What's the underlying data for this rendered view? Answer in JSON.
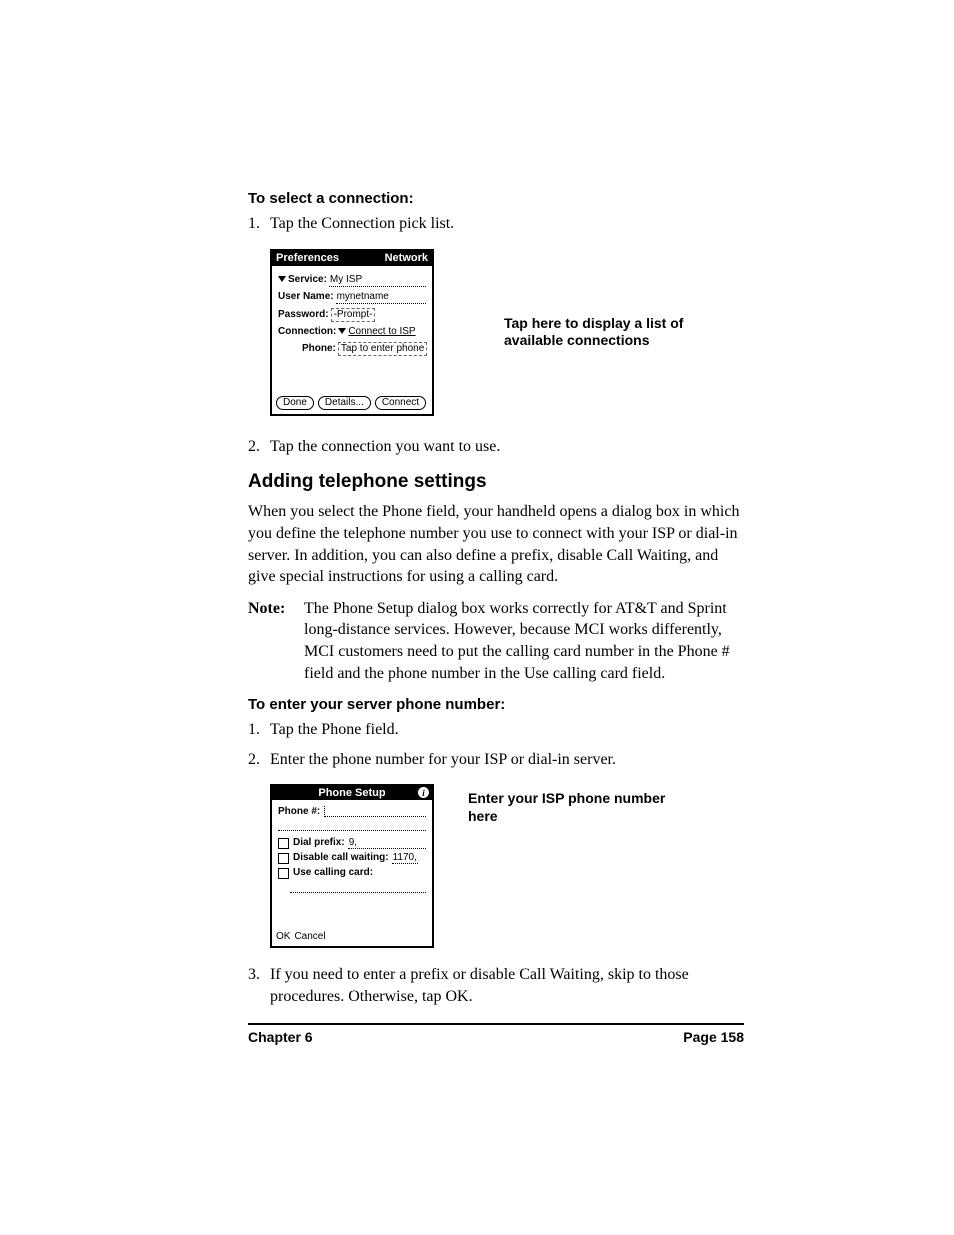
{
  "proc1": {
    "heading": "To select a connection:",
    "steps": [
      "Tap the Connection pick list.",
      "Tap the connection you want to use."
    ]
  },
  "fig1": {
    "title_left": "Preferences",
    "title_right": "Network",
    "service_label": "Service:",
    "service_value": "My ISP",
    "username_label": "User Name:",
    "username_value": "mynetname",
    "password_label": "Password:",
    "password_value": "-Prompt-",
    "connection_label": "Connection:",
    "connection_value": "Connect to ISP",
    "phone_label": "Phone:",
    "phone_value": "Tap to enter phone",
    "btn_done": "Done",
    "btn_details": "Details...",
    "btn_connect": "Connect",
    "callout": "Tap here to display a list of available connections"
  },
  "section": {
    "heading": "Adding telephone settings",
    "para": "When you select the Phone field, your handheld opens a dialog box in which you define the telephone number you use to connect with your ISP or dial-in server. In addition, you can also define a prefix, disable Call Waiting, and give special instructions for using a calling card.",
    "note_label": "Note:",
    "note_text": "The Phone Setup dialog box works correctly for AT&T and Sprint long-distance services. However, because MCI works differently, MCI customers need to put the calling card number in the Phone # field and the phone number in the Use calling card field."
  },
  "proc2": {
    "heading": "To enter your server phone number:",
    "steps": [
      "Tap the Phone field.",
      "Enter the phone number for your ISP or dial-in server.",
      "If you need to enter a prefix or disable Call Waiting, skip to those procedures. Otherwise, tap OK."
    ]
  },
  "fig2": {
    "title": "Phone Setup",
    "phone_label": "Phone #:",
    "dialprefix_label": "Dial prefix:",
    "dialprefix_value": "9,",
    "disable_label": "Disable call waiting:",
    "disable_value": "1170,",
    "callingcard_label": "Use calling card:",
    "btn_ok": "OK",
    "btn_cancel": "Cancel",
    "callout": "Enter your ISP phone number here"
  },
  "footer": {
    "left": "Chapter 6",
    "right": "Page 158"
  }
}
